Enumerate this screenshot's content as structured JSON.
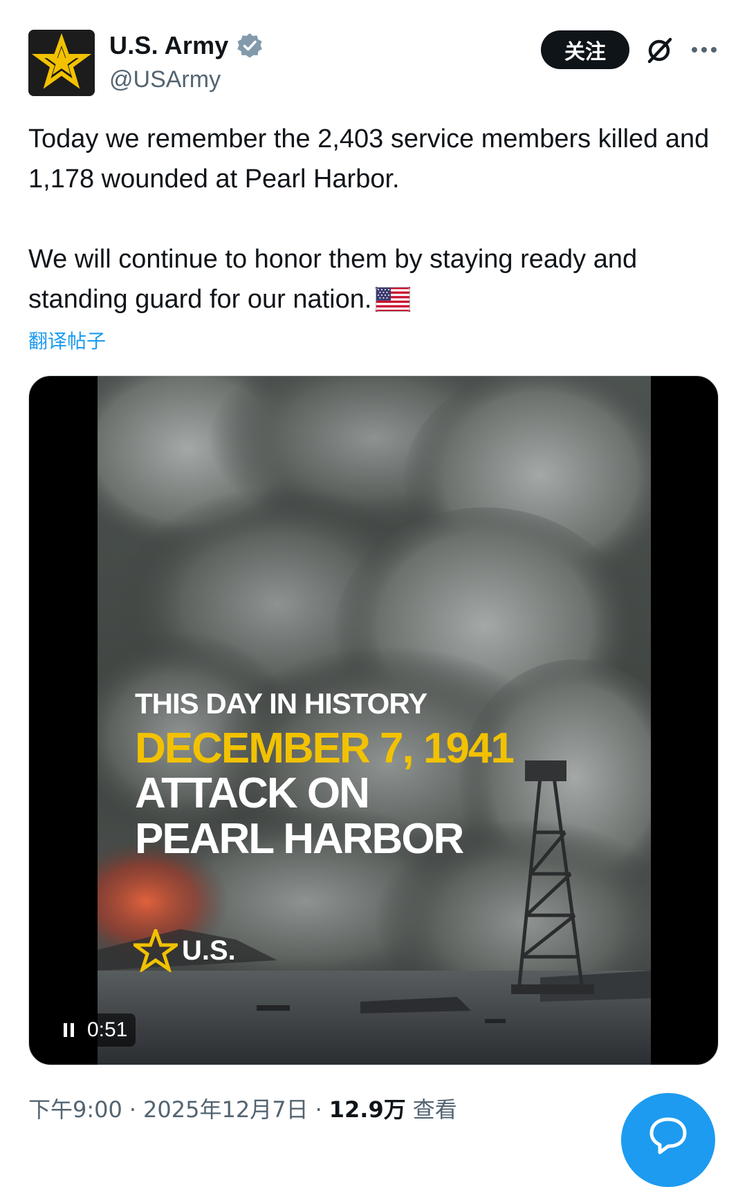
{
  "account": {
    "display_name": "U.S. Army",
    "handle": "@USArmy",
    "avatar_icon": "army-star-logo-icon",
    "verified_icon": "verified-badge-icon"
  },
  "actions": {
    "follow_label": "关注",
    "grok_icon": "grok-icon",
    "more_icon": "more-options-icon"
  },
  "tweet": {
    "line1": "Today we remember the 2,403 service members killed and 1,178 wounded at Pearl Harbor.",
    "line2": "We will continue to honor them by staying ready and standing guard for our nation.",
    "emoji_icon": "us-flag-icon",
    "translate_label": "翻译帖子"
  },
  "video": {
    "kicker": "THIS DAY IN HISTORY",
    "date": "DECEMBER 7, 1941",
    "headline_line1": "ATTACK ON",
    "headline_line2": "PEARL HARBOR",
    "brand": "U.S.",
    "duration": "0:51",
    "pause_icon": "pause-icon"
  },
  "meta": {
    "time": "下午9:00",
    "date": "2025年12月7日",
    "separator": "·",
    "views_count": "12.9万",
    "views_label": "查看"
  },
  "colors": {
    "accent": "#1d9bf0",
    "text_primary": "#0f1419",
    "text_secondary": "#536471",
    "army_gold": "#f2c200"
  }
}
